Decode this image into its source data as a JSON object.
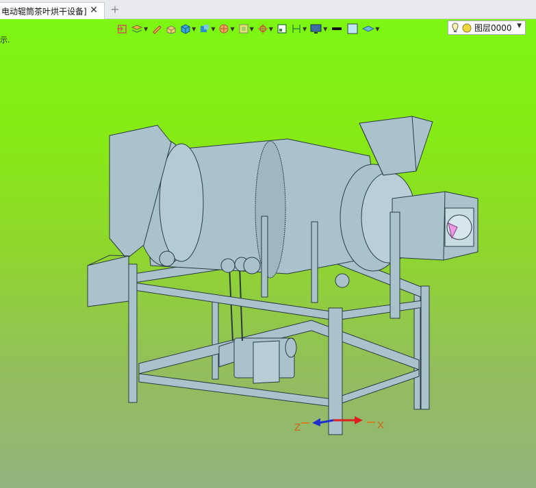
{
  "tabs": [
    {
      "label": "电动辊筒茶叶烘干设备]",
      "close_symbol": "✕"
    }
  ],
  "tab_add_symbol": "+",
  "viewport": {
    "hint_text": "示.",
    "gradient_top": "#7cf712",
    "gradient_bottom": "#93b47d"
  },
  "toolbar": {
    "items": [
      {
        "name": "exit-sketch-icon"
      },
      {
        "name": "layers-stack-icon",
        "dropdown": true
      },
      {
        "name": "pencil-icon"
      },
      {
        "name": "box-edit-icon"
      },
      {
        "name": "cube-icon",
        "dropdown": true
      },
      {
        "name": "cube-view-icon",
        "dropdown": true
      },
      {
        "name": "render-mode-icon",
        "dropdown": true
      },
      {
        "name": "display-style-icon",
        "dropdown": true
      },
      {
        "name": "snap-target-icon",
        "dropdown": true
      },
      {
        "name": "frame-icon"
      },
      {
        "name": "dimension-icon",
        "dropdown": true
      },
      {
        "name": "monitor-icon",
        "dropdown": true
      },
      {
        "name": "line-color-icon"
      },
      {
        "name": "fill-color-icon"
      },
      {
        "name": "layer-plane-icon",
        "dropdown": true
      }
    ],
    "layer_select": {
      "value": "图层0000",
      "bulb_icon": "bulb-icon",
      "sun_icon": "sun-icon"
    }
  },
  "axes": {
    "x_label": "X",
    "z_label": "Z",
    "x_color": "#e02020",
    "z_color": "#2030d0"
  },
  "colors": {
    "machine_fill": "#a9c2cc",
    "machine_stroke": "#2b3a40"
  }
}
